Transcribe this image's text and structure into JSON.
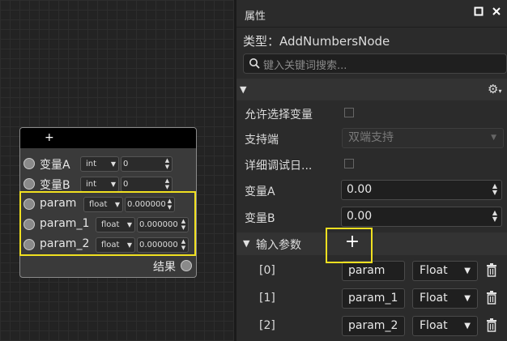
{
  "node": {
    "add_glyph": "+",
    "rows": [
      {
        "label": "变量A",
        "type": "int",
        "value": "0"
      },
      {
        "label": "变量B",
        "type": "int",
        "value": "0"
      },
      {
        "label": "param",
        "type": "float",
        "value": "0.000000"
      },
      {
        "label": "param_1",
        "type": "float",
        "value": "0.000000"
      },
      {
        "label": "param_2",
        "type": "float",
        "value": "0.000000"
      }
    ],
    "result_label": "结果"
  },
  "panel": {
    "title": "属性",
    "type_line": "类型：AddNumbersNode",
    "search_placeholder": "键入关键词搜索...",
    "allow_select_var_label": "允许选择变量",
    "support_end_label": "支持端",
    "support_end_value": "双端支持",
    "detailed_log_label": "详细调试日...",
    "var_a_label": "变量A",
    "var_a_value": "0.00",
    "var_b_label": "变量B",
    "var_b_value": "0.00",
    "input_params_label": "输入参数",
    "add_glyph": "+",
    "params": [
      {
        "index": "[0]",
        "name": "param",
        "type": "Float"
      },
      {
        "index": "[1]",
        "name": "param_1",
        "type": "Float"
      },
      {
        "index": "[2]",
        "name": "param_2",
        "type": "Float"
      }
    ]
  },
  "colors": {
    "highlight": "#f0e020",
    "node_header": "#000000",
    "panel_bg": "#2b2b2b"
  },
  "icons": [
    "maximize-icon",
    "close-icon",
    "search-icon",
    "collapse-triangle-icon",
    "gear-icon",
    "trash-icon"
  ]
}
